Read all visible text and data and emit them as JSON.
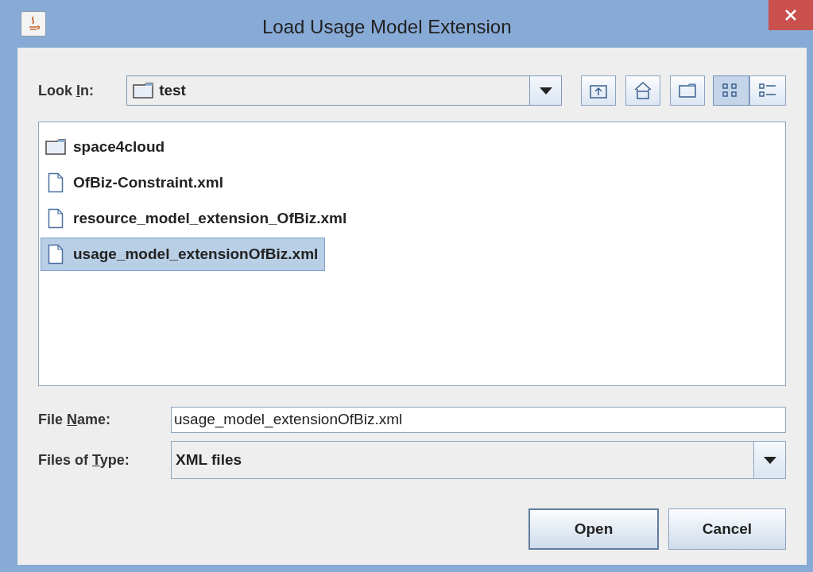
{
  "window": {
    "title": "Load Usage Model Extension"
  },
  "look_in": {
    "label_parts": [
      "Look ",
      "I",
      "n:"
    ],
    "value": "test"
  },
  "toolbar": [
    {
      "kind": "up"
    },
    {
      "kind": "home"
    },
    {
      "kind": "new-folder"
    },
    {
      "kind": "list-view",
      "selected": true
    },
    {
      "kind": "details-view",
      "selected": false
    }
  ],
  "files": [
    {
      "name": "space4cloud",
      "kind": "folder",
      "selected": false
    },
    {
      "name": "OfBiz-Constraint.xml",
      "kind": "file",
      "selected": false
    },
    {
      "name": "resource_model_extension_OfBiz.xml",
      "kind": "file",
      "selected": false
    },
    {
      "name": "usage_model_extensionOfBiz.xml",
      "kind": "file",
      "selected": true
    }
  ],
  "file_name": {
    "label_parts": [
      "File ",
      "N",
      "ame:"
    ],
    "value": "usage_model_extensionOfBiz.xml"
  },
  "file_type": {
    "label_parts": [
      "Files of ",
      "T",
      "ype:"
    ],
    "value": "XML files"
  },
  "buttons": [
    {
      "label": "Open",
      "kind": "default"
    },
    {
      "label": "Cancel",
      "kind": "normal"
    }
  ]
}
